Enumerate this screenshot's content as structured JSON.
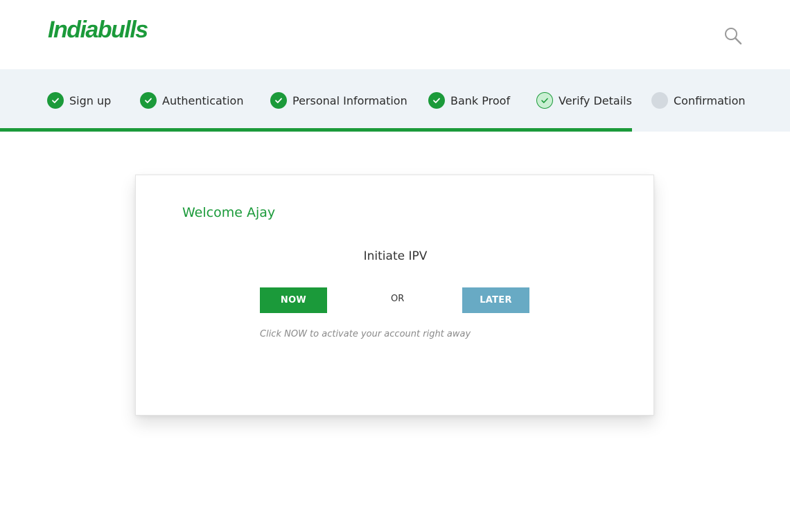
{
  "header": {
    "logo_text": "Indiabulls",
    "search_icon": "search-icon"
  },
  "steps": [
    {
      "label": "Sign up",
      "status": "done"
    },
    {
      "label": "Authentication",
      "status": "done"
    },
    {
      "label": "Personal Information",
      "status": "done"
    },
    {
      "label": "Bank Proof",
      "status": "done"
    },
    {
      "label": "Verify Details",
      "status": "current"
    },
    {
      "label": "Confirmation",
      "status": "pending"
    }
  ],
  "progress": {
    "fraction": 0.8
  },
  "card": {
    "welcome": "Welcome Ajay",
    "title": "Initiate IPV",
    "now_label": "NOW",
    "or_label": "OR",
    "later_label": "LATER",
    "hint": "Click NOW to activate your account right away"
  },
  "colors": {
    "brand_green": "#1b9a3a",
    "later_blue": "#68aac4",
    "steps_bg": "#eef3f7",
    "pending_gray": "#d3d9df"
  }
}
